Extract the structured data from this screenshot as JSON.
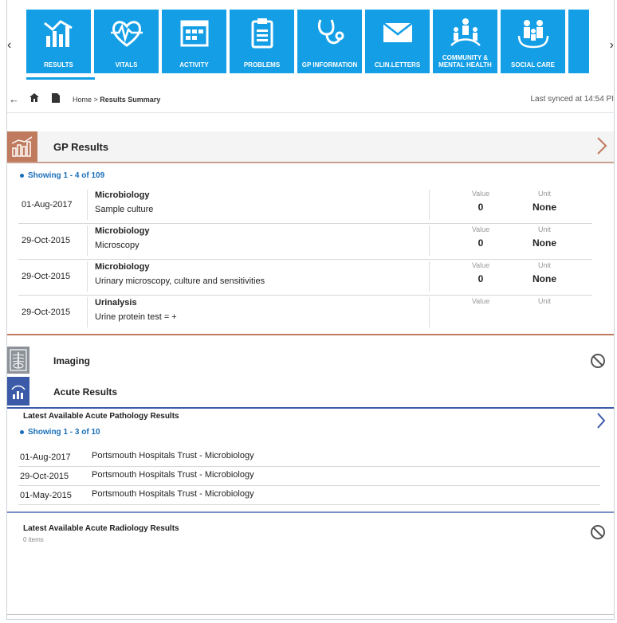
{
  "nav": {
    "tiles": [
      {
        "label": "RESULTS",
        "icon": "results-chart-icon"
      },
      {
        "label": "VITALS",
        "icon": "heart-pulse-icon"
      },
      {
        "label": "ACTIVITY",
        "icon": "calendar-icon"
      },
      {
        "label": "PROBLEMS",
        "icon": "clipboard-icon"
      },
      {
        "label": "GP INFORMATION",
        "icon": "stethoscope-icon"
      },
      {
        "label": "CLIN.LETTERS",
        "icon": "envelope-icon"
      },
      {
        "label": "COMMUNITY &\nMENTAL HEALTH",
        "icon": "community-people-icon"
      },
      {
        "label": "SOCIAL CARE",
        "icon": "family-icon"
      }
    ],
    "prev_arrow": "‹",
    "next_arrow": "›"
  },
  "breadcrumb": {
    "home": "Home",
    "separator": " > ",
    "current": "Results Summary"
  },
  "sync": {
    "text": "Last synced at 14:54 PI"
  },
  "gp_results": {
    "title": "GP Results",
    "showing": "Showing 1 - 4 of 109",
    "value_header": "Value",
    "unit_header": "Unit",
    "rows": [
      {
        "date": "01-Aug-2017",
        "category": "Microbiology",
        "description": "Sample culture",
        "value": "0",
        "unit": "None"
      },
      {
        "date": "29-Oct-2015",
        "category": "Microbiology",
        "description": "Microscopy",
        "value": "0",
        "unit": "None"
      },
      {
        "date": "29-Oct-2015",
        "category": "Microbiology",
        "description": "Urinary microscopy, culture and sensitivities",
        "value": "0",
        "unit": "None"
      },
      {
        "date": "29-Oct-2015",
        "category": "Urinalysis",
        "description": "Urine protein test = +",
        "value": "",
        "unit": ""
      }
    ]
  },
  "imaging": {
    "title": "Imaging"
  },
  "acute": {
    "title": "Acute Results",
    "pathology_title": "Latest Available Acute Pathology Results",
    "showing": "Showing 1 - 3 of 10",
    "rows": [
      {
        "date": "01-Aug-2017",
        "description": "Portsmouth Hospitals Trust - Microbiology"
      },
      {
        "date": "29-Oct-2015",
        "description": "Portsmouth Hospitals Trust - Microbiology"
      },
      {
        "date": "01-May-2015",
        "description": "Portsmouth Hospitals Trust - Microbiology"
      }
    ],
    "radiology_title": "Latest Available Acute Radiology Results",
    "radiology_count": "0 items"
  },
  "colors": {
    "tile_blue": "#139ee6",
    "gp_accent": "#c07a5e",
    "imaging_accent": "#8c9298",
    "acute_accent": "#3b5aa8",
    "link_blue": "#1a6fba"
  }
}
